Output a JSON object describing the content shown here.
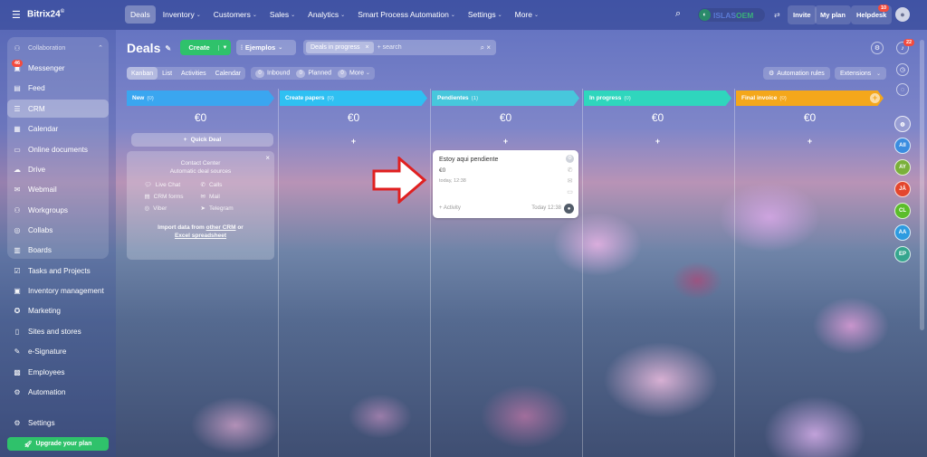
{
  "topbar": {
    "logo": "Bitrix24",
    "logo_mark": "©",
    "nav": [
      "Deals",
      "Inventory",
      "Customers",
      "Sales",
      "Analytics",
      "Smart Process Automation",
      "Settings",
      "More"
    ],
    "brand": {
      "word1": "ISLAS",
      "word2": "OEM"
    },
    "invite": "Invite",
    "my_plan": "My plan",
    "helpdesk": "Helpdesk",
    "helpdesk_badge": "10"
  },
  "sidebar": {
    "items": [
      {
        "label": "Collaboration",
        "icon": "collab-icon"
      },
      {
        "label": "Messenger",
        "icon": "chat-icon",
        "badge": "46"
      },
      {
        "label": "Feed",
        "icon": "feed-icon"
      },
      {
        "label": "CRM",
        "icon": "crm-icon"
      },
      {
        "label": "Calendar",
        "icon": "calendar-icon"
      },
      {
        "label": "Online documents",
        "icon": "docs-icon"
      },
      {
        "label": "Drive",
        "icon": "drive-icon"
      },
      {
        "label": "Webmail",
        "icon": "mail-icon"
      },
      {
        "label": "Workgroups",
        "icon": "groups-icon"
      },
      {
        "label": "Collabs",
        "icon": "collabs-icon"
      },
      {
        "label": "Boards",
        "icon": "boards-icon"
      },
      {
        "label": "Tasks and Projects",
        "icon": "tasks-icon"
      },
      {
        "label": "Inventory management",
        "icon": "inventory-icon"
      },
      {
        "label": "Marketing",
        "icon": "marketing-icon"
      },
      {
        "label": "Sites and stores",
        "icon": "sites-icon"
      },
      {
        "label": "e-Signature",
        "icon": "signature-icon"
      },
      {
        "label": "Employees",
        "icon": "employees-icon"
      },
      {
        "label": "Automation",
        "icon": "automation-icon"
      }
    ],
    "settings": "Settings",
    "upgrade": "Upgrade your plan"
  },
  "toolbar": {
    "title": "Deals",
    "create": "Create",
    "filter": "Ejemplos",
    "chip": "Deals in progress",
    "search_placeholder": "+ search",
    "notif_badge": "22"
  },
  "views": {
    "tabs": [
      "Kanban",
      "List",
      "Activities",
      "Calendar"
    ],
    "inbound": {
      "label": "Inbound",
      "count": "0"
    },
    "planned": {
      "label": "Planned",
      "count": "0"
    },
    "more": {
      "label": "More",
      "count": "0"
    },
    "automation": "Automation rules",
    "extensions": "Extensions"
  },
  "colors": {
    "new": "#3aa6f0",
    "create": "#2fc0f2",
    "pend": "#47c7dc",
    "prog": "#2fd6bd",
    "final": "#f4a71b"
  },
  "columns": [
    {
      "name": "New",
      "count": "(0)",
      "sum": "€0"
    },
    {
      "name": "Create papers",
      "count": "(0)",
      "sum": "€0"
    },
    {
      "name": "Pendientes",
      "count": "(1)",
      "sum": "€0"
    },
    {
      "name": "In progress",
      "count": "(0)",
      "sum": "€0"
    },
    {
      "name": "Final invoice",
      "count": "(0)",
      "sum": "€0"
    }
  ],
  "quick_deal": "Quick Deal",
  "contact_center": {
    "line1": "Contact Center",
    "line2": "Automatic deal sources",
    "items": [
      "Live Chat",
      "Calls",
      "CRM forms",
      "Mail",
      "Viber",
      "Telegram"
    ],
    "import1": "Import data from",
    "import_link1": "other CRM",
    "import_or": "or",
    "import_link2": "Excel spreadsheet"
  },
  "card": {
    "title": "Estoy aqui pendiente",
    "sum": "€0",
    "date": "today, 12:38",
    "activity": "+ Activity",
    "time": "Today 12:38"
  },
  "rail": [
    {
      "t": "All",
      "c": "#3b8de0"
    },
    {
      "t": "AY",
      "c": "#7ab03a"
    },
    {
      "t": "JÁ",
      "c": "#e4462d"
    },
    {
      "t": "CL",
      "c": "#5bbd2a"
    },
    {
      "t": "AA",
      "c": "#2e9be0"
    },
    {
      "t": "EP",
      "c": "#36a68e"
    }
  ]
}
